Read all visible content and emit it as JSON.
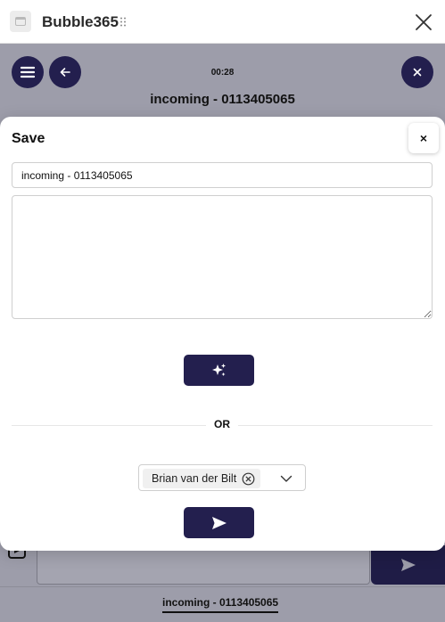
{
  "app": {
    "title": "Bubble365",
    "icon": "app-window-icon",
    "close_icon": "close-icon"
  },
  "call": {
    "timer": "00:28",
    "title": "incoming - 0113405065",
    "menu_icon": "hamburger-menu-icon",
    "back_icon": "arrow-left-icon",
    "close_icon": "close-icon"
  },
  "modal": {
    "title": "Save",
    "close_label": "×",
    "title_input_value": "incoming - 0113405065",
    "notes_value": "",
    "ai_button_icon": "sparkles-icon",
    "or_label": "OR",
    "assignee": {
      "selected": "Brian van der Bilt",
      "remove_icon": "circle-x-icon",
      "dropdown_icon": "chevron-down-icon"
    },
    "send_button_icon": "send-icon"
  },
  "bottom_tabs": [
    {
      "label": "incoming - 0113405065",
      "active": true
    }
  ],
  "colors": {
    "primary": "#231f4e",
    "overlay": "#9d9daa"
  }
}
